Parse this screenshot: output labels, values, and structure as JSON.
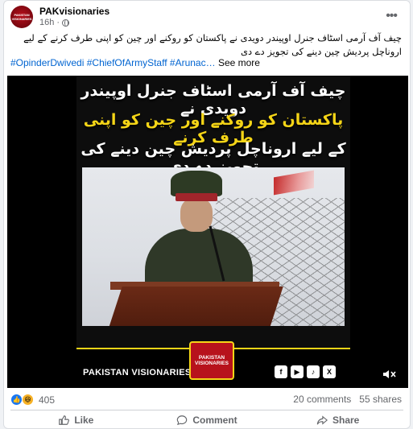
{
  "post": {
    "author": "PAKvisionaries",
    "avatar_text": "PAKISTAN VISIONARIES",
    "time": "16h",
    "separator": "·",
    "urdu_text": "چیف آف آرمی اسٹاف جنرل اوپیندر دویدی نے پاکستان کو روکنے اور چین کو اپنی طرف کرنے کے لیے اروناچل پردیش چین دینے کی تجویز دے دی",
    "hashtags": [
      "#OpinderDwivedi",
      "#ChiefOfArmyStaff",
      "#Arunac…"
    ],
    "see_more": "See more"
  },
  "video": {
    "line1": "چیف آف آرمی اسٹاف جنرل اوپیندر دویدی نے",
    "line2": "پاکستان کو روکنے اور چین کو اپنی طرف کرنے",
    "line3": "کے لیے اروناچل پردیش چین دینے کی تجویز دے دی",
    "brand": "PAKISTAN VISIONARIES",
    "logo_line1": "PAKISTAN",
    "logo_line2": "VISIONARIES",
    "social_icons": [
      "facebook-icon",
      "youtube-icon",
      "tiktok-icon",
      "x-icon"
    ],
    "accent": "#f5d517"
  },
  "engagement": {
    "reaction_icons": [
      "like-icon",
      "haha-icon"
    ],
    "reaction_count": "405",
    "comments": "20 comments",
    "shares": "55 shares"
  },
  "actions": {
    "like": "Like",
    "comment": "Comment",
    "share": "Share"
  },
  "colors": {
    "link": "#0064d1",
    "like_blue": "#1877f2",
    "muted": "#65676b"
  }
}
